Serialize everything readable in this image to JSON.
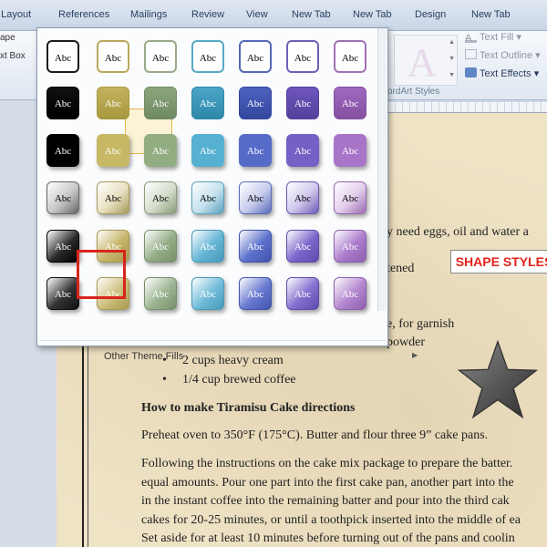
{
  "ribbon": {
    "tabs": [
      "e Layout",
      "References",
      "Mailings",
      "Review",
      "View",
      "New Tab",
      "New Tab",
      "Design",
      "New Tab"
    ],
    "left_items": [
      "ape",
      "xt Box"
    ],
    "wordart": {
      "text_fill": "Text Fill",
      "text_outline": "Text Outline",
      "text_effects": "Text Effects",
      "group_label": "ordArt Styles"
    }
  },
  "gallery": {
    "swatch_label": "Abc",
    "other_fills": "Other Theme Fills",
    "rows": [
      [
        {
          "bg": "#ffffff",
          "fg": "#000",
          "bd": "#1a1a1a"
        },
        {
          "bg": "#ffffff",
          "fg": "#000",
          "bd": "#b8a85c"
        },
        {
          "bg": "#ffffff",
          "fg": "#000",
          "bd": "#9aa98a"
        },
        {
          "bg": "#ffffff",
          "fg": "#000",
          "bd": "#58a9c4"
        },
        {
          "bg": "#ffffff",
          "fg": "#000",
          "bd": "#5668b8"
        },
        {
          "bg": "#ffffff",
          "fg": "#000",
          "bd": "#7060b6"
        },
        {
          "bg": "#ffffff",
          "fg": "#000",
          "bd": "#a070b2"
        }
      ],
      [
        {
          "bg": "#111111",
          "fg": "#fff",
          "bd": "#000"
        },
        {
          "bg": "#c3b25e",
          "fg": "#fff",
          "bd": "#a8983f"
        },
        {
          "bg": "#8ca67c",
          "fg": "#fff",
          "bd": "#6f8a62"
        },
        {
          "bg": "#4aa5c7",
          "fg": "#fff",
          "bd": "#2f88aa"
        },
        {
          "bg": "#4d62bf",
          "fg": "#fff",
          "bd": "#34479e"
        },
        {
          "bg": "#6e56bd",
          "fg": "#fff",
          "bd": "#55409d"
        },
        {
          "bg": "#a069c0",
          "fg": "#fff",
          "bd": "#8450a1"
        }
      ],
      [
        {
          "bg": "#000000",
          "fg": "#fff",
          "bd": "#000"
        },
        {
          "bg": "#c7b865",
          "fg": "#fff",
          "bd": "#c7b865"
        },
        {
          "bg": "#93ad83",
          "fg": "#fff",
          "bd": "#93ad83"
        },
        {
          "bg": "#56b0d0",
          "fg": "#fff",
          "bd": "#56b0d0"
        },
        {
          "bg": "#566bc8",
          "fg": "#fff",
          "bd": "#566bc8"
        },
        {
          "bg": "#7560c6",
          "fg": "#fff",
          "bd": "#7560c6"
        },
        {
          "bg": "#a874c8",
          "fg": "#fff",
          "bd": "#a874c8"
        }
      ],
      [
        {
          "bg": "#c7c7c7",
          "fg": "#000",
          "bd": "#666"
        },
        {
          "bg": "#e7e0c0",
          "fg": "#000",
          "bd": "#a89a5a"
        },
        {
          "bg": "#d3dcca",
          "fg": "#000",
          "bd": "#8a9a7a"
        },
        {
          "bg": "#c5e2ee",
          "fg": "#000",
          "bd": "#5aa0bc"
        },
        {
          "bg": "#c6ccec",
          "fg": "#000",
          "bd": "#5a6ab8"
        },
        {
          "bg": "#cfc6ec",
          "fg": "#000",
          "bd": "#6c5ab4"
        },
        {
          "bg": "#e2cdec",
          "fg": "#000",
          "bd": "#9a6ab0"
        }
      ],
      [
        {
          "bg": "#2a2a2a",
          "fg": "#fff",
          "bd": "#000"
        },
        {
          "bg": "#c6b56b",
          "fg": "#fff",
          "bd": "#a89a4f"
        },
        {
          "bg": "#94ad87",
          "fg": "#fff",
          "bd": "#77906a"
        },
        {
          "bg": "#65b5d5",
          "fg": "#fff",
          "bd": "#4998b8"
        },
        {
          "bg": "#5d71cc",
          "fg": "#fff",
          "bd": "#4254ad"
        },
        {
          "bg": "#7b66cb",
          "fg": "#fff",
          "bd": "#5f4bab"
        },
        {
          "bg": "#ab7bcc",
          "fg": "#fff",
          "bd": "#8e5faf"
        }
      ],
      [
        {
          "bg": "#333333",
          "fg": "#fff",
          "bd": "#111"
        },
        {
          "bg": "#cdbf7d",
          "fg": "#fff",
          "bd": "#a89a4f"
        },
        {
          "bg": "#9db593",
          "fg": "#fff",
          "bd": "#77906a"
        },
        {
          "bg": "#70bcd9",
          "fg": "#fff",
          "bd": "#4998b8"
        },
        {
          "bg": "#6779d0",
          "fg": "#fff",
          "bd": "#4254ad"
        },
        {
          "bg": "#846fcf",
          "fg": "#fff",
          "bd": "#5f4bab"
        },
        {
          "bg": "#b387d0",
          "fg": "#fff",
          "bd": "#8e5faf"
        }
      ]
    ]
  },
  "document": {
    "callout": "SHAPE STYLES",
    "line1": "y need eggs, oil and water a",
    "line2": "tened",
    "line3": "e, for garnish",
    "line4": "powder",
    "bullet1": "2 cups heavy cream",
    "bullet2": "1/4 cup brewed coffee",
    "heading": "How to make Tiramisu Cake directions",
    "para1": "Preheat oven to 350°F (175°C). Butter and flour three 9” cake pans.",
    "para2_lines": [
      "Following the instructions on the cake mix package to prepare the batter.",
      "equal amounts. Pour one part into the first cake pan, another part into the",
      "in the instant coffee into the remaining batter and pour into the third cak",
      "cakes for 20-25 minutes, or until a toothpick inserted into the middle of ea",
      "Set aside for at least 10 minutes before turning out of the pans and coolin"
    ]
  }
}
